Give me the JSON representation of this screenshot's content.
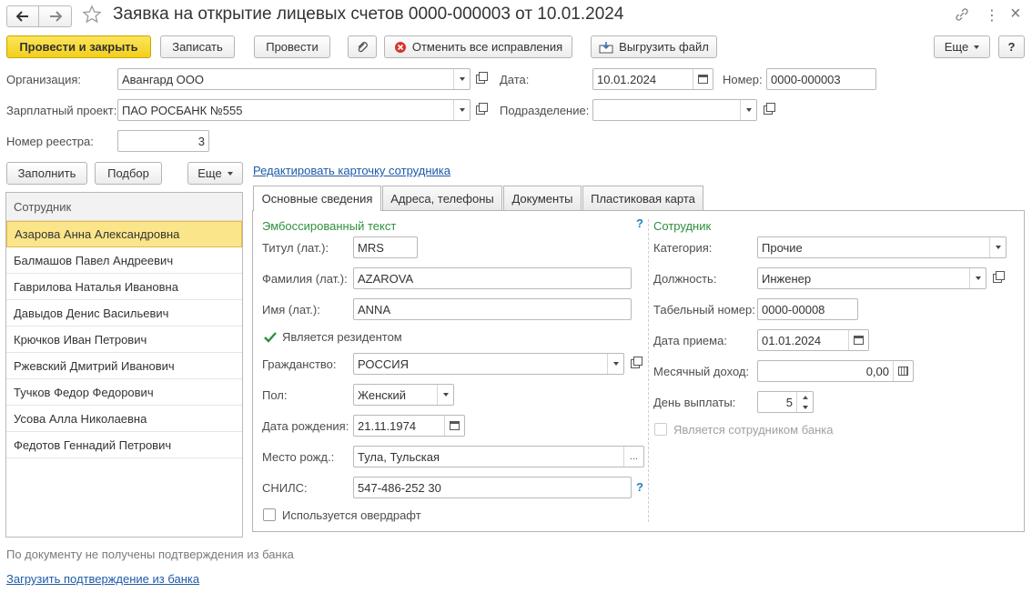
{
  "window": {
    "title": "Заявка на открытие лицевых счетов 0000-000003 от 10.01.2024",
    "close_glyph": "×",
    "more_glyph": "⋮",
    "link_glyph": "🔗"
  },
  "toolbar": {
    "post_close": "Провести и закрыть",
    "save": "Записать",
    "post": "Провести",
    "cancel_fixes": "Отменить все исправления",
    "export_file": "Выгрузить файл",
    "more": "Еще",
    "help": "?"
  },
  "header": {
    "org_label": "Организация:",
    "org_value": "Авангард ООО",
    "date_label": "Дата:",
    "date_value": "10.01.2024",
    "number_label": "Номер:",
    "number_value": "0000-000003",
    "salary_label": "Зарплатный проект:",
    "salary_value": "ПАО РОСБАНК №555",
    "dept_label": "Подразделение:",
    "dept_value": "",
    "registry_label": "Номер реестра:",
    "registry_value": "3"
  },
  "left_panel": {
    "fill": "Заполнить",
    "select": "Подбор",
    "more": "Еще",
    "column": "Сотрудник",
    "employees": [
      "Азарова Анна Александровна",
      "Балмашов Павел Андреевич",
      "Гаврилова Наталья Ивановна",
      "Давыдов Денис Васильевич",
      "Крючков Иван Петрович",
      "Ржевский Дмитрий Иванович",
      "Тучков Федор Федорович",
      "Усова Алла Николаевна",
      "Федотов Геннадий Петрович"
    ],
    "selected_index": 0
  },
  "edit_card_link": "Редактировать карточку сотрудника",
  "tabs": [
    "Основные сведения",
    "Адреса, телефоны",
    "Документы",
    "Пластиковая карта"
  ],
  "embossed": {
    "section": "Эмбоссированный текст",
    "help": "?",
    "title_label": "Титул (лат.):",
    "title_value": "MRS",
    "surname_label": "Фамилия (лат.):",
    "surname_value": "AZAROVA",
    "name_label": "Имя (лат.):",
    "name_value": "ANNA",
    "resident_label": "Является резидентом",
    "resident_checked": true,
    "citizenship_label": "Гражданство:",
    "citizenship_value": "РОССИЯ",
    "gender_label": "Пол:",
    "gender_value": "Женский",
    "birth_label": "Дата рождения:",
    "birth_value": "21.11.1974",
    "birthplace_label": "Место рожд.:",
    "birthplace_value": "Тула, Тульская",
    "birthplace_btn": "...",
    "snils_label": "СНИЛС:",
    "snils_value": "547-486-252 30",
    "snils_help": "?",
    "overdraft_label": "Используется овердрафт",
    "overdraft_checked": false
  },
  "employee": {
    "section": "Сотрудник",
    "category_label": "Категория:",
    "category_value": "Прочие",
    "position_label": "Должность:",
    "position_value": "Инженер",
    "tabnum_label": "Табельный номер:",
    "tabnum_value": "0000-00008",
    "hire_label": "Дата приема:",
    "hire_value": "01.01.2024",
    "income_label": "Месячный доход:",
    "income_value": "0,00",
    "payday_label": "День выплаты:",
    "payday_value": "5",
    "bank_employee_label": "Является сотрудником банка",
    "bank_employee_checked": false
  },
  "footer": {
    "status": "По документу не получены подтверждения из банка",
    "load_link": "Загрузить подтверждение из банка"
  },
  "colors": {
    "accent_yellow": "#f3cf1c",
    "link_blue": "#1e5aa8",
    "section_green": "#2f8f3e",
    "selection": "#fbe58a"
  }
}
